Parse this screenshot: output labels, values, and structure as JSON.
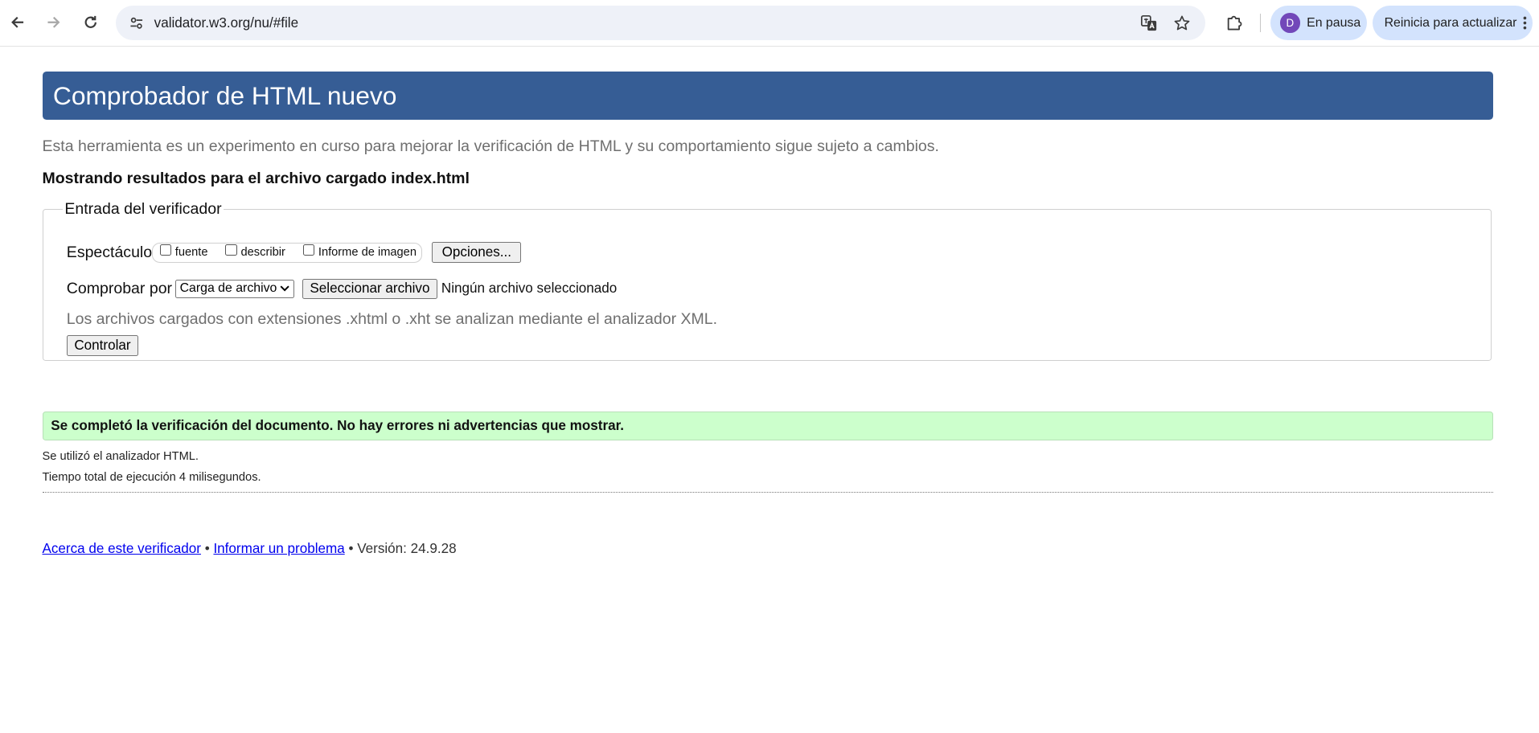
{
  "browser": {
    "url": "validator.w3.org/nu/#file",
    "profile_initial": "D",
    "profile_label": "En pausa",
    "update_label": "Reinicia para actualizar"
  },
  "page": {
    "title": "Comprobador de HTML nuevo",
    "intro": "Esta herramienta es un experimento en curso para mejorar la verificación de HTML y su comportamiento sigue sujeto a cambios.",
    "showing_results": "Mostrando resultados para el archivo cargado index.html"
  },
  "checker_input": {
    "legend": "Entrada del verificador",
    "show_label": "Espectáculo",
    "show_options": [
      {
        "label": "fuente",
        "checked": false
      },
      {
        "label": "describir",
        "checked": false
      },
      {
        "label": "Informe de imagen",
        "checked": false
      }
    ],
    "options_button": "Opciones...",
    "check_by_label": "Comprobar por",
    "check_by_selected": "Carga de archivo",
    "choose_file_button": "Seleccionar archivo",
    "no_file_text": "Ningún archivo seleccionado",
    "note": "Los archivos cargados con extensiones .xhtml o .xht se analizan mediante el analizador XML.",
    "check_button": "Controlar"
  },
  "results": {
    "success_message": "Se completó la verificación del documento. No hay errores ni advertencias que mostrar.",
    "parser_info": "Se utilizó el analizador HTML.",
    "execution_time": "Tiempo total de ejecución 4 milisegundos."
  },
  "footer": {
    "about_link": "Acerca de este verificador",
    "separator": "•",
    "report_link": "Informar un problema",
    "version": "Versión: 24.9.28"
  },
  "colors": {
    "header_bg": "#365d95",
    "success_bg": "#ccffcc",
    "chip_bg": "#d3e3fd",
    "avatar_bg": "#7248b9"
  }
}
